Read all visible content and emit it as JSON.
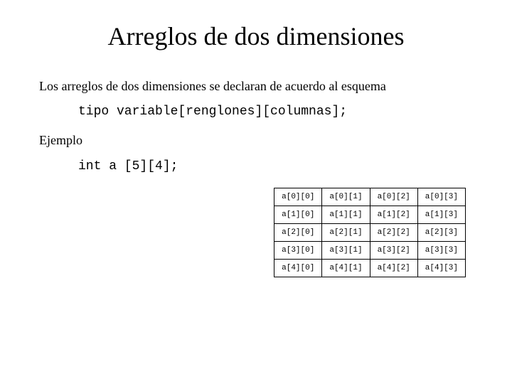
{
  "title": "Arreglos de dos dimensiones",
  "intro": "Los arreglos de dos dimensiones se declaran de acuerdo al esquema",
  "syntax": "tipo variable[renglones][columnas];",
  "example_label": "Ejemplo",
  "example_code": "int a [5][4];",
  "table": {
    "rows": [
      [
        "a[0][0]",
        "a[0][1]",
        "a[0][2]",
        "a[0][3]"
      ],
      [
        "a[1][0]",
        "a[1][1]",
        "a[1][2]",
        "a[1][3]"
      ],
      [
        "a[2][0]",
        "a[2][1]",
        "a[2][2]",
        "a[2][3]"
      ],
      [
        "a[3][0]",
        "a[3][1]",
        "a[3][2]",
        "a[3][3]"
      ],
      [
        "a[4][0]",
        "a[4][1]",
        "a[4][2]",
        "a[4][3]"
      ]
    ]
  }
}
